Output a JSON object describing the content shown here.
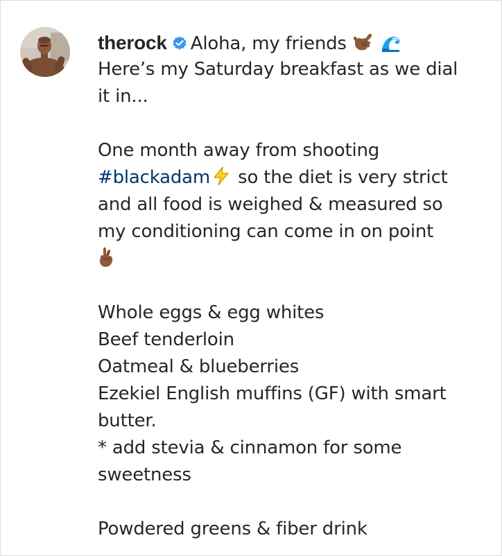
{
  "post": {
    "username": "therock",
    "greeting": "Aloha, my friends",
    "line_breakfast_1": "Here’s my Saturday breakfast as we dial",
    "line_breakfast_2": "it in...",
    "line_shoot": "One month away from shooting",
    "hashtag": "#blackadam",
    "line_diet_tail": "so the diet is very strict",
    "line_weighed": "and all food is weighed & measured so",
    "line_conditioning": "my conditioning can come in on point",
    "menu": [
      "Whole eggs & egg whites",
      "Beef tenderloin",
      "Oatmeal & blueberries",
      "Ezekiel English muffins (GF) with smart",
      "butter.",
      "* add stevia & cinnamon for some",
      "sweetness"
    ],
    "drink": "Powdered greens & fiber drink"
  },
  "icons": {
    "verified": "verified-badge-icon",
    "shaka": "call-me-hand-emoji",
    "wave": "water-wave-emoji",
    "lightning": "high-voltage-emoji",
    "fingers": "crossed-fingers-emoji"
  },
  "colors": {
    "text": "#262626",
    "hashtag": "#00376b",
    "verified": "#3897f0",
    "border": "#dbdbdb",
    "skin": "#8d5a3b"
  }
}
